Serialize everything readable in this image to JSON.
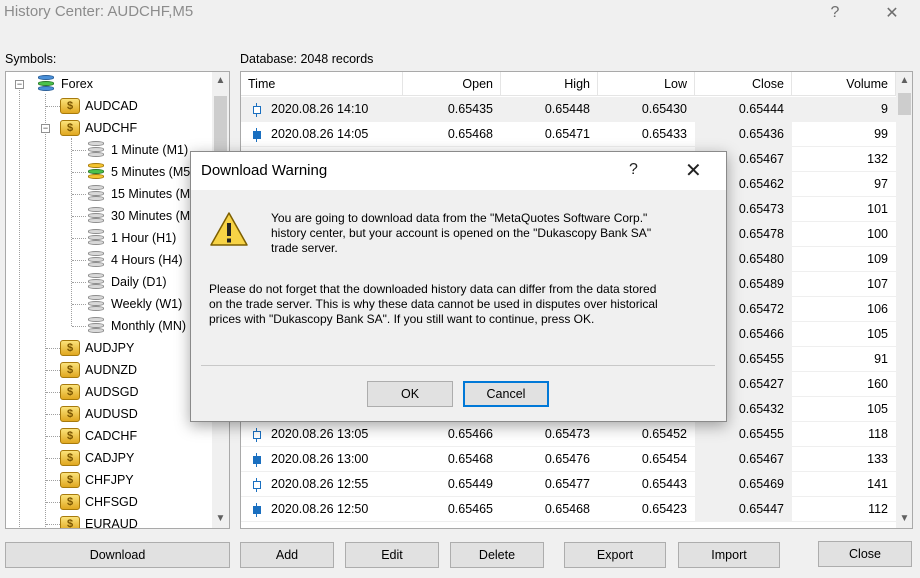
{
  "window": {
    "title": "History Center: AUDCHF,M5",
    "help_glyph": "?",
    "close_glyph": "✕"
  },
  "symbols_label": "Symbols:",
  "database_label": "Database: 2048 records",
  "tree": {
    "forex": "Forex",
    "audcad": "AUDCAD",
    "audchf": "AUDCHF",
    "timeframes": [
      "1 Minute (M1)",
      "5 Minutes (M5)",
      "15 Minutes (M15)",
      "30 Minutes (M30)",
      "1 Hour (H1)",
      "4 Hours (H4)",
      "Daily (D1)",
      "Weekly (W1)",
      "Monthly (MN)"
    ],
    "symbols": [
      "AUDJPY",
      "AUDNZD",
      "AUDSGD",
      "AUDUSD",
      "CADCHF",
      "CADJPY",
      "CHFJPY",
      "CHFSGD",
      "EURAUD"
    ],
    "coin_glyph": "$"
  },
  "table": {
    "headers": {
      "time": "Time",
      "open": "Open",
      "high": "High",
      "low": "Low",
      "close": "Close",
      "volume": "Volume"
    },
    "top_rows": [
      {
        "time": "2020.08.26 14:10",
        "open": "0.65435",
        "high": "0.65448",
        "low": "0.65430",
        "close": "0.65444",
        "volume": "9"
      },
      {
        "time": "2020.08.26 14:05",
        "open": "0.65468",
        "high": "0.65471",
        "low": "0.65433",
        "close": "0.65436",
        "volume": "99"
      }
    ],
    "partial_rows": [
      {
        "close": "0.65467",
        "volume": "132"
      },
      {
        "close": "0.65462",
        "volume": "97"
      },
      {
        "close": "0.65473",
        "volume": "101"
      },
      {
        "close": "0.65478",
        "volume": "100"
      },
      {
        "close": "0.65480",
        "volume": "109"
      },
      {
        "close": "0.65489",
        "volume": "107"
      },
      {
        "close": "0.65472",
        "volume": "106"
      },
      {
        "close": "0.65466",
        "volume": "105"
      },
      {
        "close": "0.65455",
        "volume": "91"
      },
      {
        "close": "0.65427",
        "volume": "160"
      },
      {
        "close": "0.65432",
        "volume": "105"
      }
    ],
    "bottom_rows": [
      {
        "time": "2020.08.26 13:05",
        "open": "0.65466",
        "high": "0.65473",
        "low": "0.65452",
        "close": "0.65455",
        "volume": "118"
      },
      {
        "time": "2020.08.26 13:00",
        "open": "0.65468",
        "high": "0.65476",
        "low": "0.65454",
        "close": "0.65467",
        "volume": "133"
      },
      {
        "time": "2020.08.26 12:55",
        "open": "0.65449",
        "high": "0.65477",
        "low": "0.65443",
        "close": "0.65469",
        "volume": "141"
      },
      {
        "time": "2020.08.26 12:50",
        "open": "0.65465",
        "high": "0.65468",
        "low": "0.65423",
        "close": "0.65447",
        "volume": "112"
      }
    ]
  },
  "buttons": {
    "download": "Download",
    "add": "Add",
    "edit": "Edit",
    "delete": "Delete",
    "export": "Export",
    "import": "Import",
    "close": "Close"
  },
  "dialog": {
    "title": "Download Warning",
    "help_glyph": "?",
    "close_glyph": "✕",
    "message1_line1": "You are going to download data from the \"MetaQuotes Software Corp.\"",
    "message1_line2": "history center, but your account is opened on the \"Dukascopy Bank SA\"",
    "message1_line3": "trade server.",
    "message2_line1": "Please do not forget that the downloaded history data can differ from the data stored",
    "message2_line2": "on the trade server. This is why these data cannot be used in disputes over historical",
    "message2_line3": "prices with \"Dukascopy Bank SA\". If you still want to continue, press OK.",
    "ok": "OK",
    "cancel": "Cancel"
  },
  "colors": {
    "accent": "#0078d7",
    "candle": "#1a6fc0",
    "coin": "#f4c430"
  }
}
